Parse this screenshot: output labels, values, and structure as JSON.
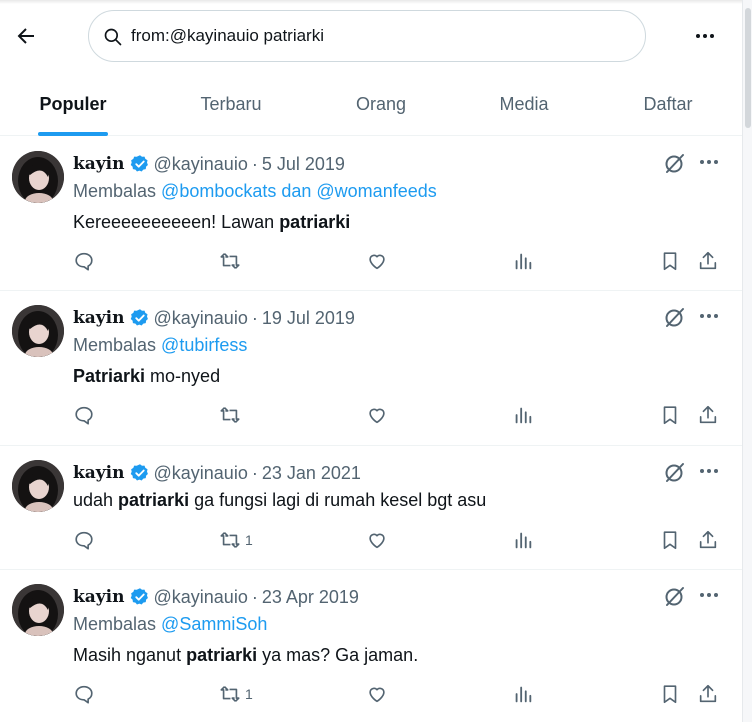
{
  "search": {
    "query": "from:@kayinauio patriarki"
  },
  "tabs": [
    {
      "label": "Populer",
      "active": true
    },
    {
      "label": "Terbaru",
      "active": false
    },
    {
      "label": "Orang",
      "active": false
    },
    {
      "label": "Media",
      "active": false
    },
    {
      "label": "Daftar",
      "active": false
    }
  ],
  "colors": {
    "accent": "#1d9bf0",
    "text": "#0f1419",
    "muted": "#536471"
  },
  "tweets": [
    {
      "name": "kayin",
      "handle": "@kayinauio",
      "date": "5 Jul 2019",
      "reply_prefix": "Membalas",
      "reply_mentions": "@bombockats dan @womanfeeds",
      "text_before": "Kereeeeeeeeeen! Lawan ",
      "text_bold": "patriarki",
      "text_after": "",
      "retweets": ""
    },
    {
      "name": "kayin",
      "handle": "@kayinauio",
      "date": "19 Jul 2019",
      "reply_prefix": "Membalas",
      "reply_mentions": "@tubirfess",
      "text_before": "",
      "text_bold": "Patriarki",
      "text_after": " mo-nyed",
      "retweets": ""
    },
    {
      "name": "kayin",
      "handle": "@kayinauio",
      "date": "23 Jan 2021",
      "reply_prefix": "",
      "reply_mentions": "",
      "text_before": "udah ",
      "text_bold": "patriarki",
      "text_after": " ga fungsi lagi di rumah kesel bgt asu",
      "retweets": "1"
    },
    {
      "name": "kayin",
      "handle": "@kayinauio",
      "date": "23 Apr 2019",
      "reply_prefix": "Membalas",
      "reply_mentions": "@SammiSoh",
      "text_before": "Masih nganut ",
      "text_bold": "patriarki",
      "text_after": " ya mas? Ga jaman.",
      "retweets": "1"
    }
  ],
  "icons": {
    "back": "arrow-left-icon",
    "search": "search-icon",
    "more": "more-horizontal-icon",
    "verified": "verified-badge-icon",
    "grok": "grok-icon",
    "reply": "reply-icon",
    "retweet": "retweet-icon",
    "like": "like-icon",
    "views": "views-icon",
    "bookmark": "bookmark-icon",
    "share": "share-icon"
  }
}
